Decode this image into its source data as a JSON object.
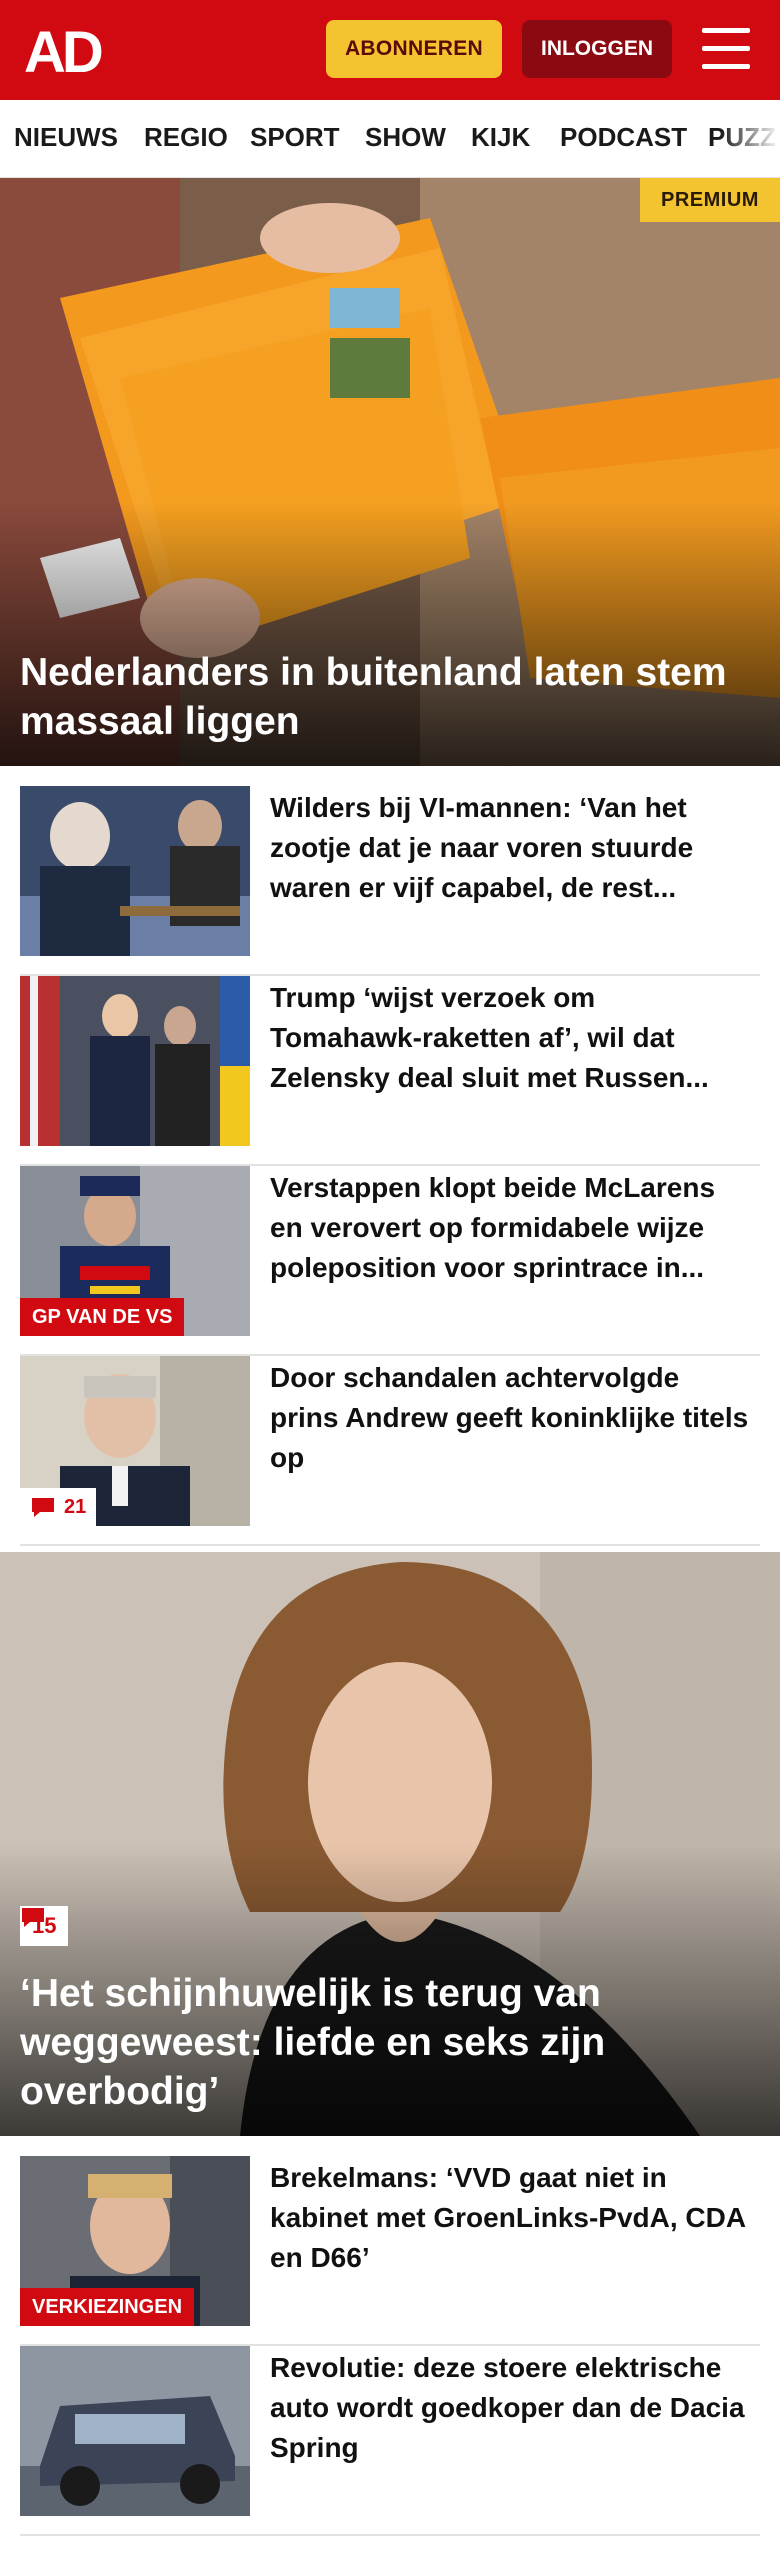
{
  "header": {
    "logo": "AD",
    "subscribe_label": "ABONNEREN",
    "login_label": "INLOGGEN",
    "brand_color": "#d10a11"
  },
  "nav": {
    "items": [
      {
        "label": "NIEUWS"
      },
      {
        "label": "REGIO"
      },
      {
        "label": "SPORT"
      },
      {
        "label": "SHOW"
      },
      {
        "label": "KIJK"
      },
      {
        "label": "PODCAST"
      },
      {
        "label": "PUZZ"
      }
    ]
  },
  "hero": {
    "badge": "PREMIUM",
    "title": "Nederlanders in buitenland laten stem massaal liggen"
  },
  "articles": [
    {
      "title": "Wilders bij VI-mannen: ‘Van het zootje dat je naar voren stuurde waren er vijf capabel, de rest...",
      "tag": "",
      "comments": ""
    },
    {
      "title": "Trump ‘wijst verzoek om Tomahawk-raketten af’, wil dat Zelensky deal sluit met Russen...",
      "tag": "",
      "comments": ""
    },
    {
      "title": "Verstappen klopt beide McLarens en verovert op formidabele wijze poleposition voor sprintrace in...",
      "tag": "GP VAN DE VS",
      "comments": ""
    },
    {
      "title": "Door schandalen achtervolgde prins Andrew geeft koninklijke titels op",
      "tag": "",
      "comments": "21"
    }
  ],
  "hero2": {
    "comments": "15",
    "title": "‘Het schijnhuwelijk is terug van weggeweest: liefde en seks zijn overbodig’"
  },
  "articles2": [
    {
      "title": "Brekelmans: ‘VVD gaat niet in kabinet met GroenLinks-PvdA, CDA en D66’",
      "tag": "VERKIEZINGEN"
    },
    {
      "title": "Revolutie: deze stoere elektri­sche auto wordt goedkoper dan de Dacia Spring",
      "tag": ""
    }
  ],
  "icons": {
    "menu": "hamburger-menu-icon",
    "comment": "comment-bubble-icon"
  }
}
